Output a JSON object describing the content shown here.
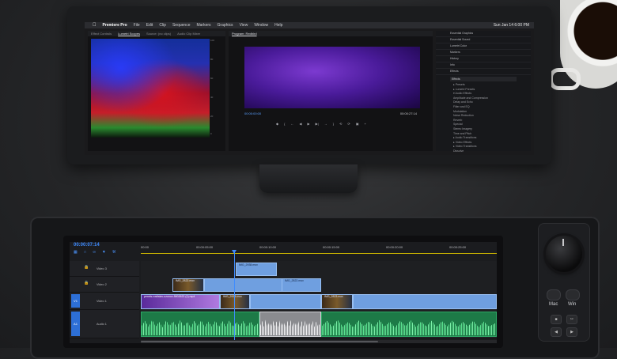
{
  "menubar": {
    "app": "Premiere Pro",
    "items": [
      "File",
      "Edit",
      "Clip",
      "Sequence",
      "Markers",
      "Graphics",
      "View",
      "Window",
      "Help"
    ],
    "clock": "Sun Jan 14  6:00 PM"
  },
  "scopes": {
    "tabs": [
      "Effect Controls",
      "Lumetri Scopes",
      "Source: (no clips)",
      "Audio Clip Mixer"
    ],
    "active_tab": "Lumetri Scopes",
    "ticks": [
      "100",
      "90",
      "80",
      "70",
      "60",
      "50",
      "40",
      "30",
      "20",
      "10",
      "0"
    ]
  },
  "program": {
    "title": "Program: Redbird",
    "timecode": "00:00:00:00",
    "duration": "00:00:27:14",
    "transport": [
      "◆",
      "{",
      "←",
      "◀",
      "▶",
      "▶|",
      "→",
      "}",
      "⟲",
      "⟳",
      "▣",
      "+"
    ]
  },
  "effects": {
    "panels": [
      "Essential Graphics",
      "Essential Sound",
      "Lumetri Color",
      "Markers",
      "History",
      "Info",
      "Effects"
    ],
    "search": "Effects",
    "tree": [
      "▸ Presets",
      "▸ Lumetri Presets",
      "▾ Audio Effects",
      "   Amplitude and Compression",
      "   Delay and Echo",
      "   Filter and EQ",
      "   Modulation",
      "   Noise Reduction",
      "   Reverb",
      "   Special",
      "   Stereo Imagery",
      "   Time and Pitch",
      "▸ Audio Transitions",
      "▸ Video Effects",
      "▸ Video Transitions",
      "   Dissolve"
    ]
  },
  "timeline": {
    "timecode": "00:00:07:14",
    "ruler": [
      "00:00",
      "00:00:05:00",
      "00:00:10:00",
      "00:00:15:00",
      "00:00:20:00",
      "00:00:25:00"
    ],
    "tracks": [
      {
        "id": "V3",
        "name": "Video 3"
      },
      {
        "id": "V2",
        "name": "Video 2"
      },
      {
        "id": "V1",
        "name": "Video 1"
      },
      {
        "id": "A1",
        "name": "Audio 1"
      }
    ],
    "clips": {
      "v3": "IMG_2938.mov",
      "v2a": "IMG_2822.mov",
      "v2b": "IMG_2822.mov",
      "v1a": "pexels-rostislav-uzunov-5802622 (1).mp4",
      "v1b": "IMG_2938.mov",
      "v1c": "IMG_2823.mov"
    }
  },
  "controller": {
    "mac": "Mac",
    "win": "Win"
  }
}
